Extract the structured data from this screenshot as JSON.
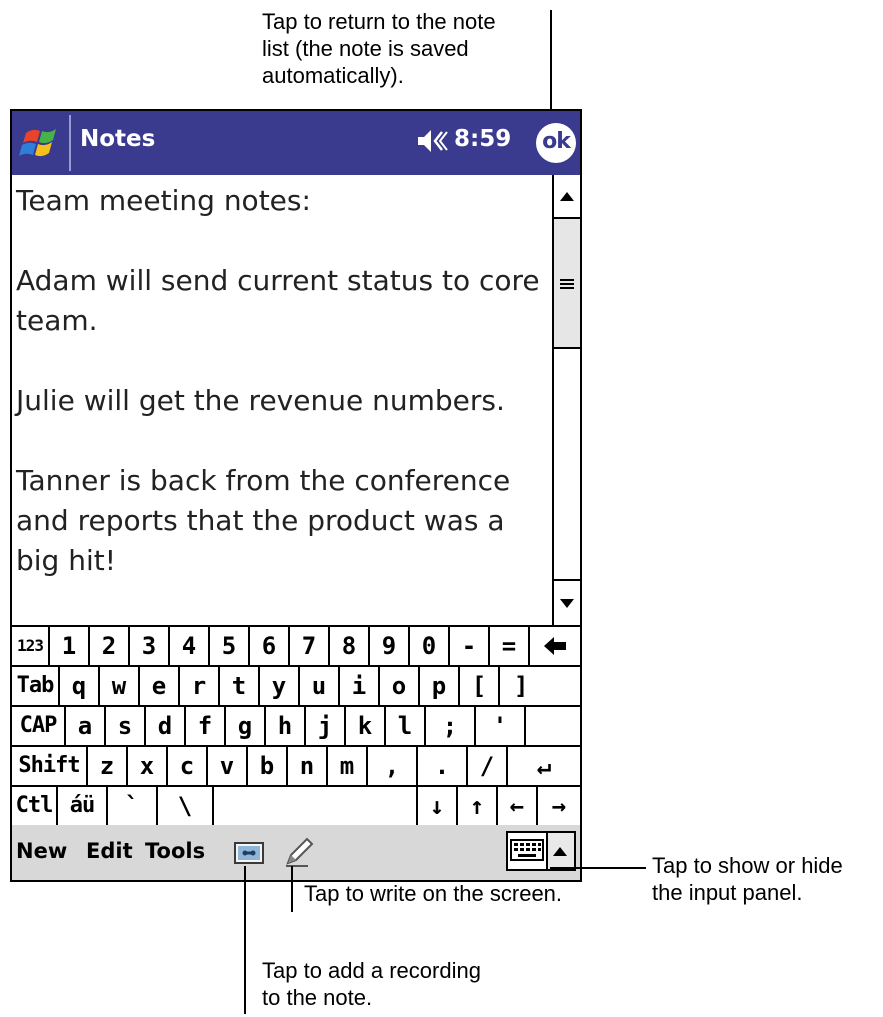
{
  "callouts": {
    "top": [
      "Tap to return to the note",
      "list (the note is saved",
      "automatically)."
    ],
    "right": [
      "Tap to show or hide",
      "the input panel."
    ],
    "write": "Tap to write on the screen.",
    "record": [
      "Tap to add a recording",
      "to the note."
    ]
  },
  "titlebar": {
    "app_title": "Notes",
    "clock": "8:59",
    "ok_label": "ok",
    "color": "#3a3a8e"
  },
  "note": {
    "lines": [
      "Team meeting notes:",
      "",
      "Adam will send current status to core",
      "team.",
      "",
      "Julie will get the revenue numbers.",
      "",
      "Tanner is back from the conference",
      "and reports that the product was a",
      "big hit!"
    ]
  },
  "keyboard": {
    "row1": [
      "123",
      "1",
      "2",
      "3",
      "4",
      "5",
      "6",
      "7",
      "8",
      "9",
      "0",
      "-",
      "=",
      "🡄"
    ],
    "row2": [
      "Tab",
      "q",
      "w",
      "e",
      "r",
      "t",
      "y",
      "u",
      "i",
      "o",
      "p",
      "[",
      "]"
    ],
    "row3": [
      "CAP",
      "a",
      "s",
      "d",
      "f",
      "g",
      "h",
      "j",
      "k",
      "l",
      ";",
      "'"
    ],
    "row4": [
      "Shift",
      "z",
      "x",
      "c",
      "v",
      "b",
      "n",
      "m",
      ",",
      ".",
      "/",
      "↵"
    ],
    "row5": [
      "Ctl",
      "áü",
      "`",
      "\\",
      "",
      "↓",
      "↑",
      "←",
      "→"
    ]
  },
  "cmdbar": {
    "new": "New",
    "edit": "Edit",
    "tools": "Tools",
    "recording_icon": "recording-icon",
    "pen_icon": "pen-icon",
    "keyboard_icon": "keyboard-icon"
  }
}
